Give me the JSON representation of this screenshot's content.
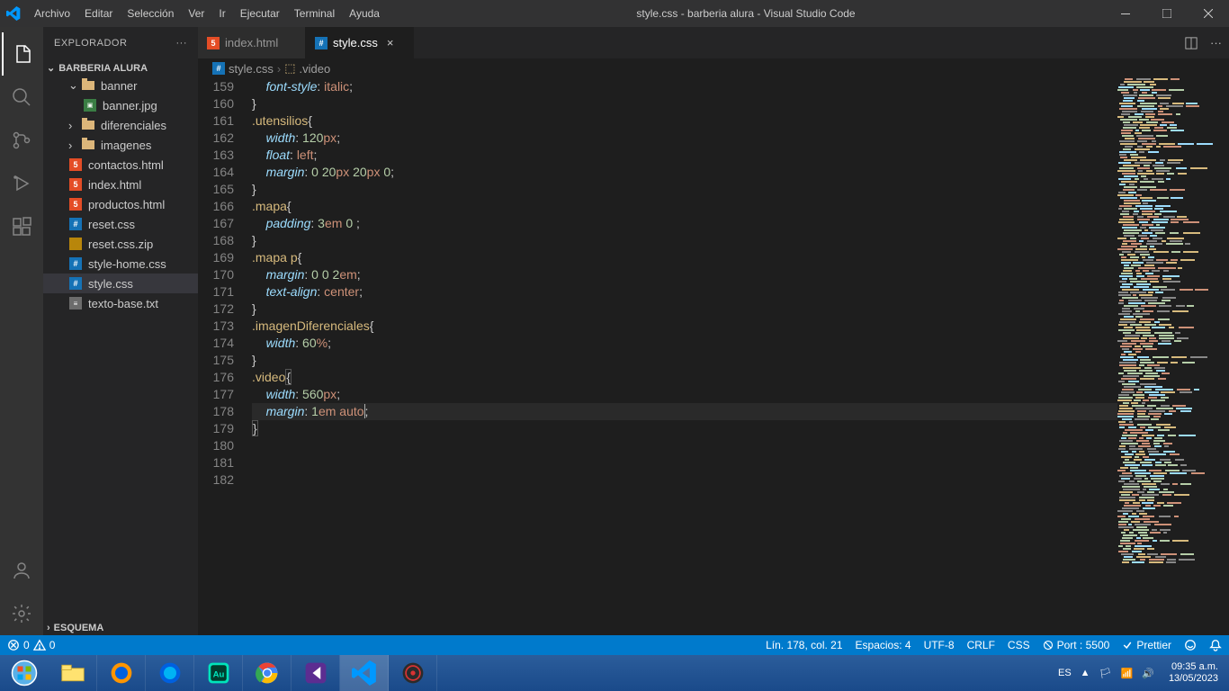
{
  "window_title": "style.css - barberia alura - Visual Studio Code",
  "menu": {
    "archivo": "Archivo",
    "editar": "Editar",
    "seleccion": "Selección",
    "ver": "Ver",
    "ir": "Ir",
    "ejecutar": "Ejecutar",
    "terminal": "Terminal",
    "ayuda": "Ayuda"
  },
  "sidebar": {
    "title": "EXPLORADOR",
    "project": "BARBERIA ALURA",
    "esquema": "ESQUEMA",
    "items": {
      "banner": "banner",
      "bannerjpg": "banner.jpg",
      "diferenciales": "diferenciales",
      "imagenes": "imagenes",
      "contactos": "contactos.html",
      "index": "index.html",
      "productos": "productos.html",
      "reset": "reset.css",
      "resetzip": "reset.css.zip",
      "stylehome": "style-home.css",
      "style": "style.css",
      "texto": "texto-base.txt"
    }
  },
  "tabs": {
    "index": "index.html",
    "style": "style.css"
  },
  "breadcrumb": {
    "file": "style.css",
    "symbol": ".video"
  },
  "statusbar": {
    "errors": "0",
    "warnings": "0",
    "position": "Lín. 178, col. 21",
    "spaces": "Espacios: 4",
    "encoding": "UTF-8",
    "eol": "CRLF",
    "lang": "CSS",
    "port": "Port : 5500",
    "prettier": "Prettier"
  },
  "code": {
    "lines": [
      159,
      160,
      161,
      162,
      163,
      164,
      165,
      166,
      167,
      168,
      169,
      170,
      171,
      172,
      173,
      174,
      175,
      176,
      177,
      178,
      179,
      180,
      181,
      182
    ]
  },
  "taskbar": {
    "lang": "ES",
    "time1": "09:35 a.m.",
    "time2": "13/05/2023"
  }
}
